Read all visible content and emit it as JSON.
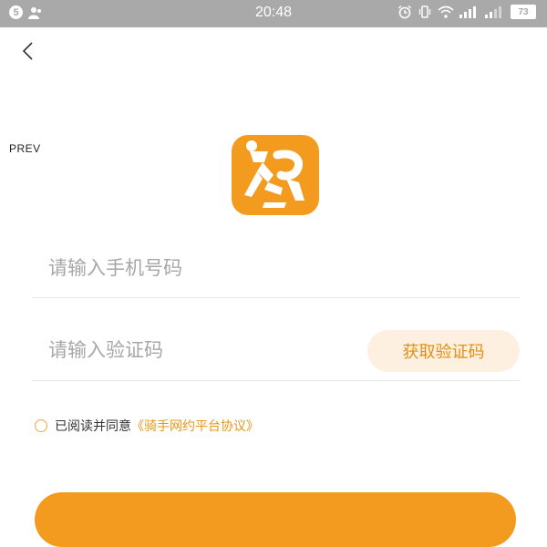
{
  "status_bar": {
    "left_badge": "5",
    "time": "20:48",
    "battery": "73"
  },
  "nav": {
    "prev_label": "PREV"
  },
  "form": {
    "phone_placeholder": "请输入手机号码",
    "code_placeholder": "请输入验证码",
    "get_code_label": "获取验证码"
  },
  "agreement": {
    "text": "已阅读并同意",
    "link": "《骑手网约平台协议》"
  },
  "colors": {
    "accent": "#f39b1e",
    "link": "#e8951a",
    "status_bar": "#a9a9a9"
  },
  "icons": [
    "back-chevron-icon",
    "alarm-icon",
    "vibrate-icon",
    "wifi-icon",
    "signal-icon",
    "battery-icon",
    "user-icon",
    "app-logo-icon"
  ]
}
